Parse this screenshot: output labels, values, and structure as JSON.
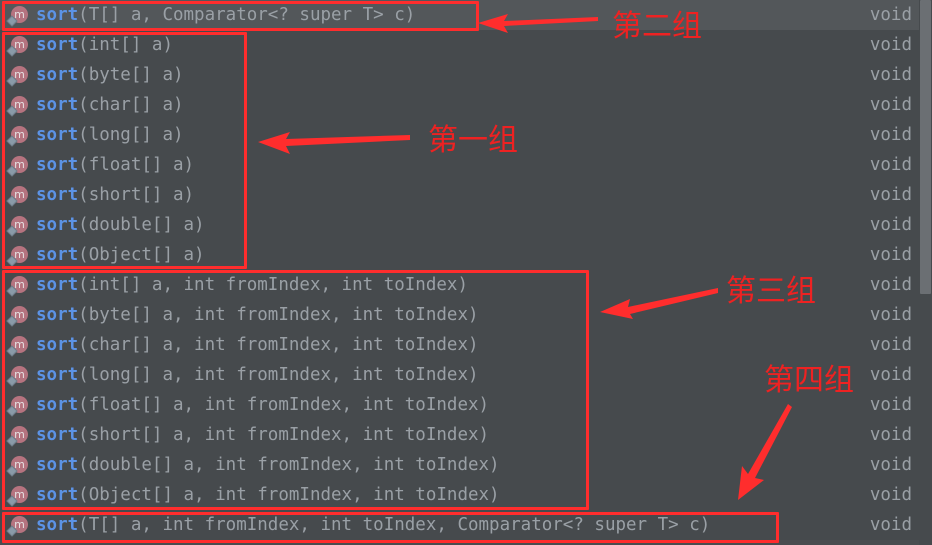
{
  "editor": {
    "theme_background": "#464a4d",
    "selected_row_background": "#53575a",
    "method_color": "#5c93e6",
    "param_color": "#9aa0a6",
    "annotation_color": "#ff2d2d"
  },
  "icons": {
    "method": "method-icon",
    "method_letter": "m",
    "scrollbar": "scrollbar-thumb"
  },
  "completion_list": {
    "rows": [
      {
        "name": "sort",
        "params": "(T[] a, Comparator<? super T> c)",
        "type": "void",
        "selected": true
      },
      {
        "name": "sort",
        "params": "(int[] a)",
        "type": "void",
        "selected": false
      },
      {
        "name": "sort",
        "params": "(byte[] a)",
        "type": "void",
        "selected": false
      },
      {
        "name": "sort",
        "params": "(char[] a)",
        "type": "void",
        "selected": false
      },
      {
        "name": "sort",
        "params": "(long[] a)",
        "type": "void",
        "selected": false
      },
      {
        "name": "sort",
        "params": "(float[] a)",
        "type": "void",
        "selected": false
      },
      {
        "name": "sort",
        "params": "(short[] a)",
        "type": "void",
        "selected": false
      },
      {
        "name": "sort",
        "params": "(double[] a)",
        "type": "void",
        "selected": false
      },
      {
        "name": "sort",
        "params": "(Object[] a)",
        "type": "void",
        "selected": false
      },
      {
        "name": "sort",
        "params": "(int[] a, int fromIndex, int toIndex)",
        "type": "void",
        "selected": false
      },
      {
        "name": "sort",
        "params": "(byte[] a, int fromIndex, int toIndex)",
        "type": "void",
        "selected": false
      },
      {
        "name": "sort",
        "params": "(char[] a, int fromIndex, int toIndex)",
        "type": "void",
        "selected": false
      },
      {
        "name": "sort",
        "params": "(long[] a, int fromIndex, int toIndex)",
        "type": "void",
        "selected": false
      },
      {
        "name": "sort",
        "params": "(float[] a, int fromIndex, int toIndex)",
        "type": "void",
        "selected": false
      },
      {
        "name": "sort",
        "params": "(short[] a, int fromIndex, int toIndex)",
        "type": "void",
        "selected": false
      },
      {
        "name": "sort",
        "params": "(double[] a, int fromIndex, int toIndex)",
        "type": "void",
        "selected": false
      },
      {
        "name": "sort",
        "params": "(Object[] a, int fromIndex, int toIndex)",
        "type": "void",
        "selected": false
      },
      {
        "name": "sort",
        "params": "(T[] a, int fromIndex, int toIndex, Comparator<? super T> c)",
        "type": "void",
        "selected": false
      }
    ]
  },
  "annotations": {
    "group_two": {
      "label": "第二组"
    },
    "group_one": {
      "label": "第一组"
    },
    "group_three": {
      "label": "第三组"
    },
    "group_four": {
      "label": "第四组"
    }
  }
}
